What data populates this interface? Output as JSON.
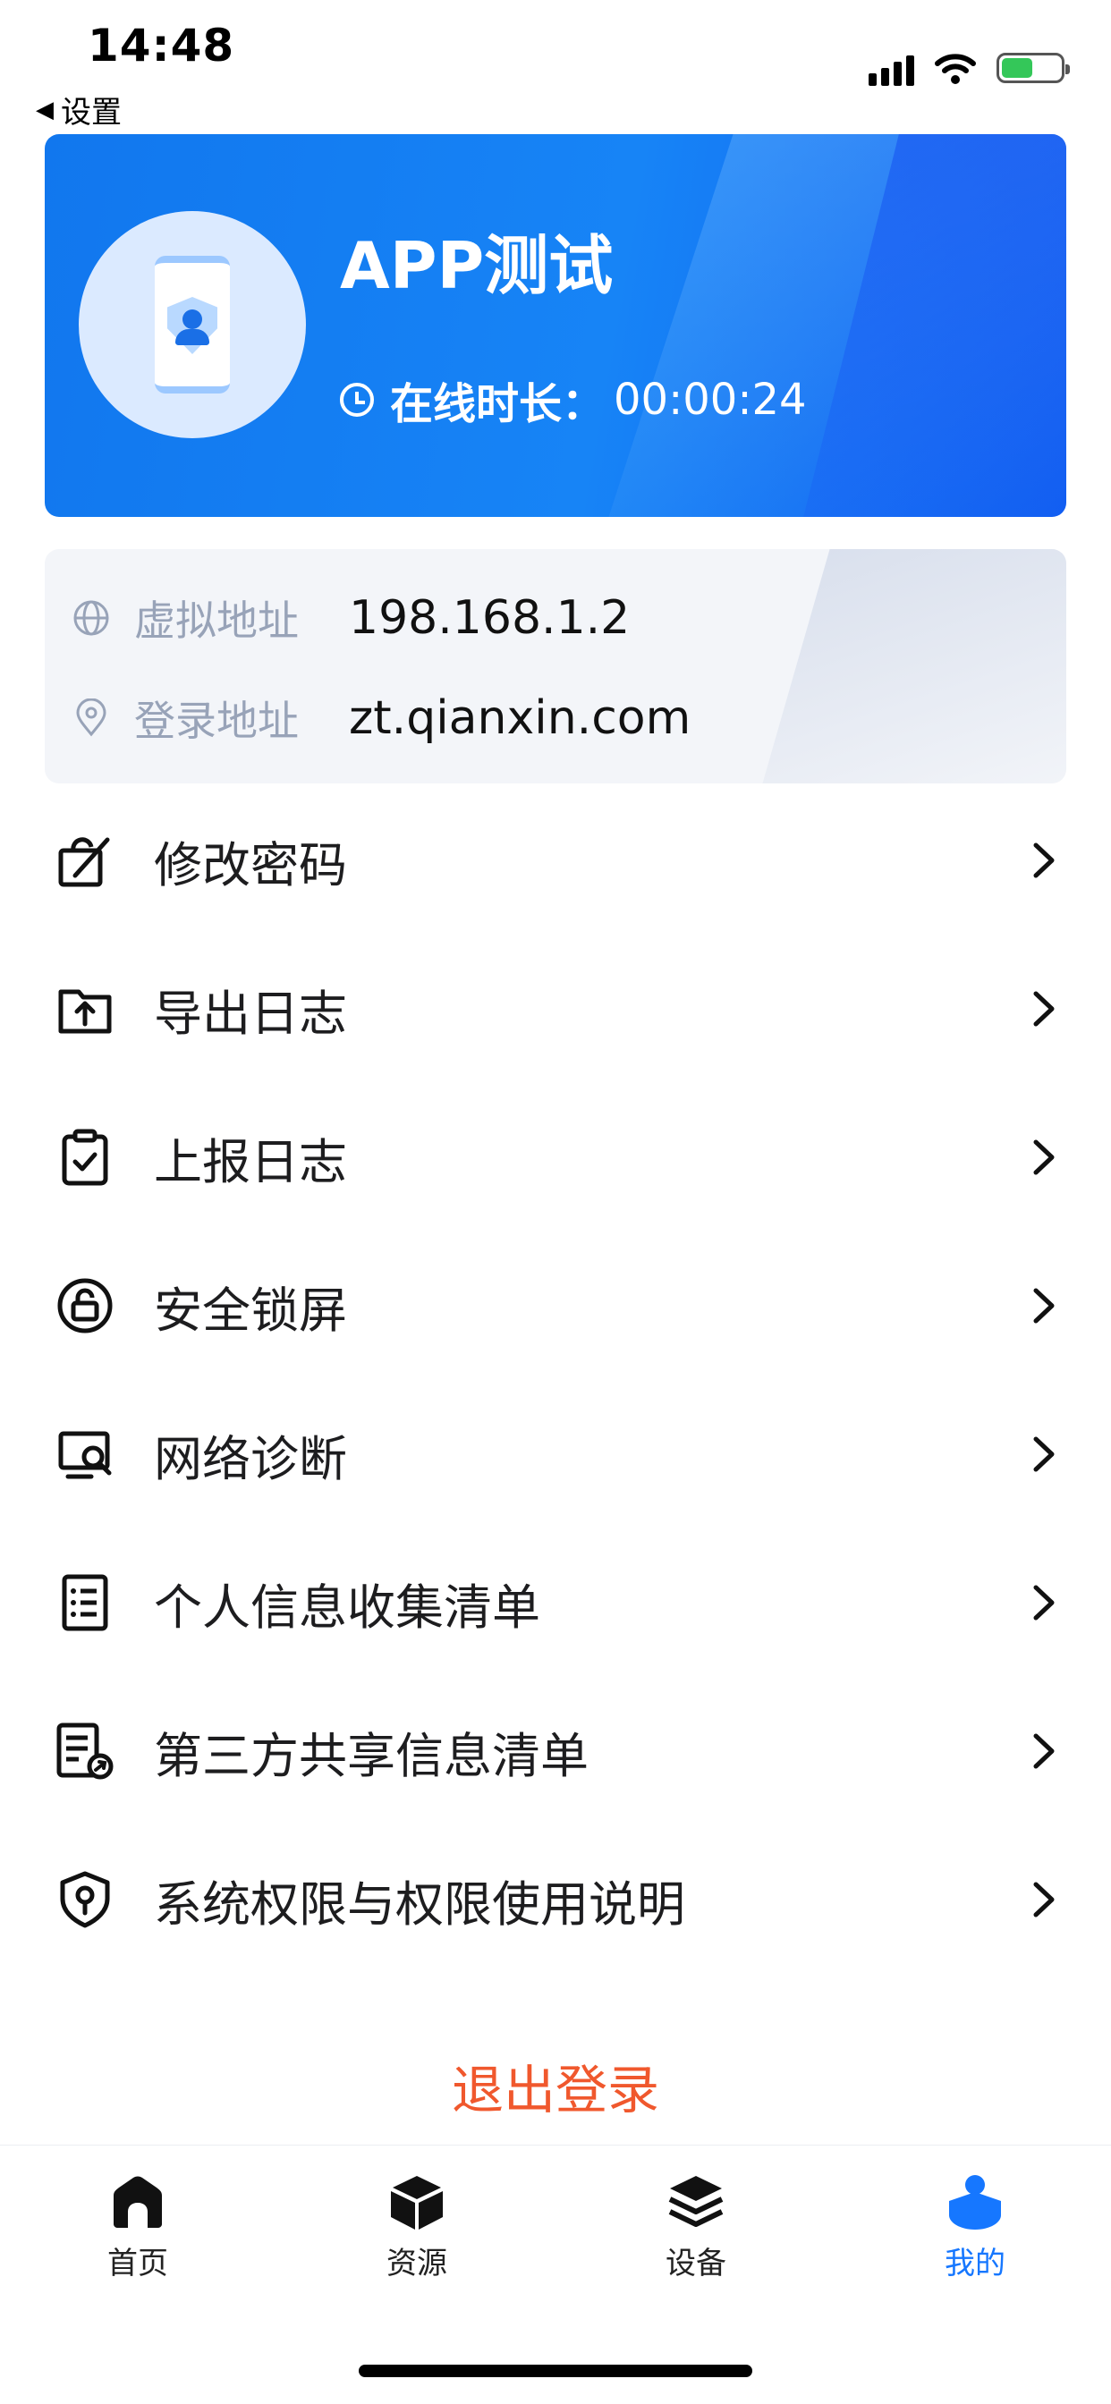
{
  "status_bar": {
    "time": "14:48",
    "back_label": "设置"
  },
  "profile": {
    "name": "APP测试",
    "online_label": "在线时长：",
    "online_duration": "00:00:24"
  },
  "info": {
    "virtual_address_label": "虚拟地址",
    "virtual_address": "198.168.1.2",
    "login_address_label": "登录地址",
    "login_address": "zt.qianxin.com"
  },
  "menu": {
    "items": [
      {
        "label": "修改密码",
        "icon": "edit-password-icon"
      },
      {
        "label": "导出日志",
        "icon": "export-log-icon"
      },
      {
        "label": "上报日志",
        "icon": "report-log-icon"
      },
      {
        "label": "安全锁屏",
        "icon": "lock-screen-icon"
      },
      {
        "label": "网络诊断",
        "icon": "network-diagnosis-icon"
      },
      {
        "label": "个人信息收集清单",
        "icon": "document-list-icon"
      },
      {
        "label": "第三方共享信息清单",
        "icon": "shared-list-icon"
      },
      {
        "label": "系统权限与权限使用说明",
        "icon": "shield-key-icon"
      }
    ]
  },
  "logout_label": "退出登录",
  "tabs": [
    {
      "label": "首页",
      "icon": "home-icon",
      "active": false
    },
    {
      "label": "资源",
      "icon": "box-icon",
      "active": false
    },
    {
      "label": "设备",
      "icon": "layers-icon",
      "active": false
    },
    {
      "label": "我的",
      "icon": "profile-icon",
      "active": true
    }
  ],
  "colors": {
    "accent": "#1677ff",
    "logout": "#f0582d",
    "card_start": "#1177ee",
    "card_end": "#0f5cf0"
  }
}
